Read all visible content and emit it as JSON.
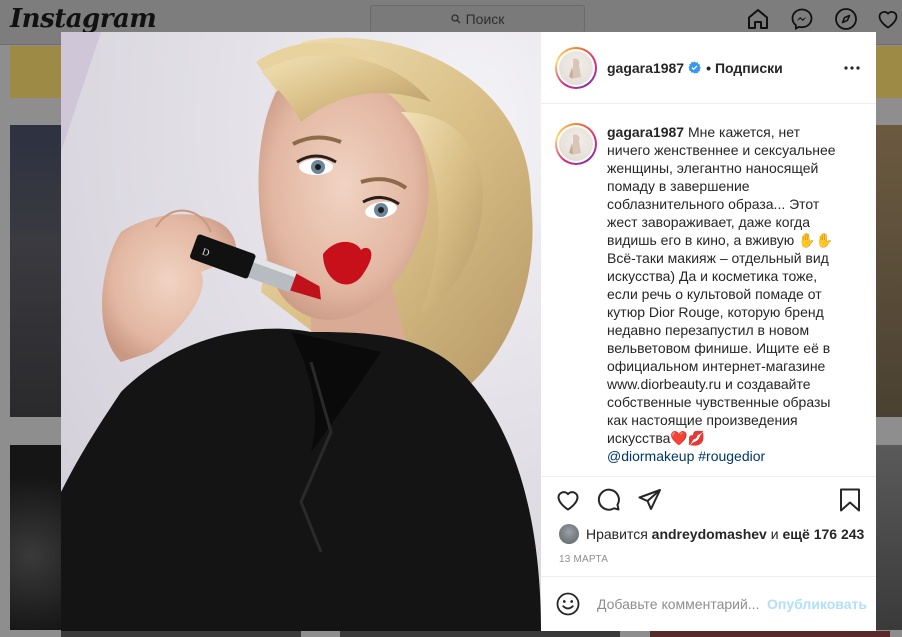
{
  "app": {
    "logo": "Instagram",
    "search_placeholder": "Поиск"
  },
  "post": {
    "author": "gagara1987",
    "follow_status": "Подписки",
    "caption": "Мне кажется, нет ничего женственнее и сексуальнее женщины, элегантно наносящей помаду в завершение соблазнительного образа... Этот жест завораживает, даже когда видишь его в кино, а вживую ✋✋ Всё-таки макияж – отдельный вид искусства) Да и косметика тоже, если речь о культовой помаде от кутюр Dior Rouge, которую бренд недавно перезапустил в новом вельветовом финише. Ищите её в официальном интернет-магазине www.diorbeauty.ru и создавайте собственные чувственные образы как настоящие произведения искусства❤️💋",
    "tags": "@diormakeup #rougedior",
    "likes_prefix": "Нравится",
    "likes_user": "andreydomashev",
    "likes_connector": "и",
    "likes_rest": "ещё 176 243",
    "date": "13 марта"
  },
  "comment": {
    "placeholder": "Добавьте комментарий...",
    "publish": "Опубликовать"
  },
  "icons": {
    "home": "home-icon",
    "messenger": "messenger-icon",
    "explore": "compass-icon",
    "activity": "heart-icon",
    "more": "more-icon",
    "like": "heart-icon",
    "comment": "comment-icon",
    "share": "share-icon",
    "save": "bookmark-icon",
    "emoji": "smile-icon",
    "verified": "verified-badge-icon"
  },
  "colors": {
    "verified": "#3897f0",
    "link": "#00376b",
    "publish_disabled": "#b2dffc",
    "muted": "#8e8e8e"
  }
}
